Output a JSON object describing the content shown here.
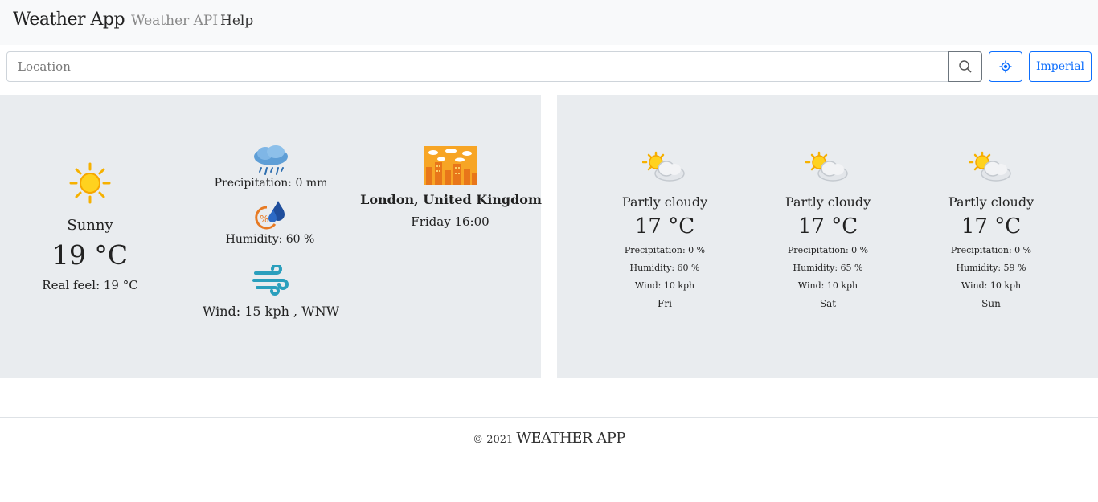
{
  "navbar": {
    "brand": "Weather App",
    "links": [
      "Weather API",
      "Help"
    ]
  },
  "search": {
    "placeholder": "Location",
    "value": "",
    "unit_toggle_label": "Imperial"
  },
  "current": {
    "condition": "Sunny",
    "temperature": "19 °C",
    "real_feel": "Real feel: 19 °C",
    "precipitation": "Precipitation: 0 mm",
    "humidity": "Humidity: 60 %",
    "wind": "Wind: 15 kph , WNW",
    "location": "London, United Kingdom",
    "datetime": "Friday 16:00"
  },
  "forecast": [
    {
      "condition": "Partly cloudy",
      "temperature": "17 °C",
      "precipitation": "Precipitation: 0 %",
      "humidity": "Humidity: 60 %",
      "wind": "Wind: 10 kph",
      "day": "Fri"
    },
    {
      "condition": "Partly cloudy",
      "temperature": "17 °C",
      "precipitation": "Precipitation: 0 %",
      "humidity": "Humidity: 65 %",
      "wind": "Wind: 10 kph",
      "day": "Sat"
    },
    {
      "condition": "Partly cloudy",
      "temperature": "17 °C",
      "precipitation": "Precipitation: 0 %",
      "humidity": "Humidity: 59 %",
      "wind": "Wind: 10 kph",
      "day": "Sun"
    }
  ],
  "footer": {
    "copyright": "© 2021",
    "app_name": "WEATHER APP"
  },
  "icons": {
    "current": "sun-icon",
    "precipitation": "rain-cloud-icon",
    "humidity": "humidity-icon",
    "wind": "wind-icon",
    "city": "city-icon",
    "forecast": "partly-cloudy-icon",
    "search": "search-icon",
    "location": "crosshair-icon"
  },
  "colors": {
    "accent": "#0d6efd",
    "panel": "#e9ecef",
    "navbar": "#f8f9fa"
  }
}
